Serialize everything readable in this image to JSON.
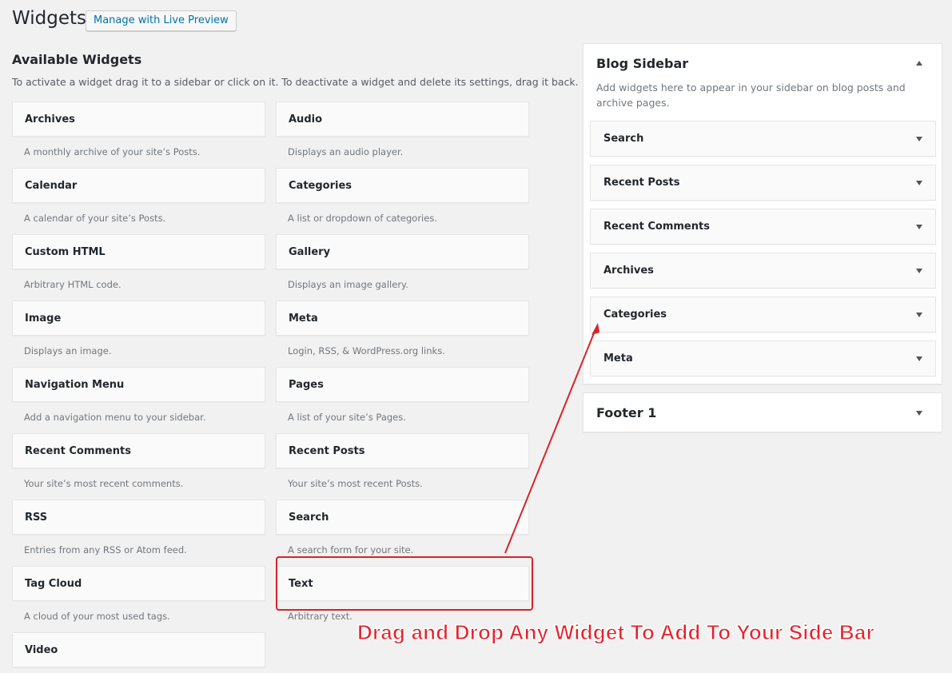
{
  "header": {
    "title": "Widgets",
    "live_preview_label": "Manage with Live Preview"
  },
  "available": {
    "title": "Available Widgets",
    "description": "To activate a widget drag it to a sidebar or click on it. To deactivate a widget and delete its settings, drag it back.",
    "widgets": [
      {
        "name": "Archives",
        "desc": "A monthly archive of your site’s Posts."
      },
      {
        "name": "Audio",
        "desc": "Displays an audio player."
      },
      {
        "name": "Calendar",
        "desc": "A calendar of your site’s Posts."
      },
      {
        "name": "Categories",
        "desc": "A list or dropdown of categories."
      },
      {
        "name": "Custom HTML",
        "desc": "Arbitrary HTML code."
      },
      {
        "name": "Gallery",
        "desc": "Displays an image gallery."
      },
      {
        "name": "Image",
        "desc": "Displays an image."
      },
      {
        "name": "Meta",
        "desc": "Login, RSS, & WordPress.org links."
      },
      {
        "name": "Navigation Menu",
        "desc": "Add a navigation menu to your sidebar."
      },
      {
        "name": "Pages",
        "desc": "A list of your site’s Pages."
      },
      {
        "name": "Recent Comments",
        "desc": "Your site’s most recent comments."
      },
      {
        "name": "Recent Posts",
        "desc": "Your site’s most recent Posts."
      },
      {
        "name": "RSS",
        "desc": "Entries from any RSS or Atom feed."
      },
      {
        "name": "Search",
        "desc": "A search form for your site."
      },
      {
        "name": "Tag Cloud",
        "desc": "A cloud of your most used tags."
      },
      {
        "name": "Text",
        "desc": "Arbitrary text."
      },
      {
        "name": "Video",
        "desc": ""
      }
    ]
  },
  "blog_sidebar": {
    "title": "Blog Sidebar",
    "description": "Add widgets here to appear in your sidebar on blog posts and archive pages.",
    "widgets": [
      "Search",
      "Recent Posts",
      "Recent Comments",
      "Archives",
      "Categories",
      "Meta"
    ]
  },
  "footer_sidebar": {
    "title": "Footer 1"
  },
  "annotation": {
    "text": "Drag and Drop Any Widget To Add To Your Side Bar",
    "color": "#e8222b"
  },
  "colors": {
    "link": "#0073aa",
    "background": "#f1f1f1"
  }
}
